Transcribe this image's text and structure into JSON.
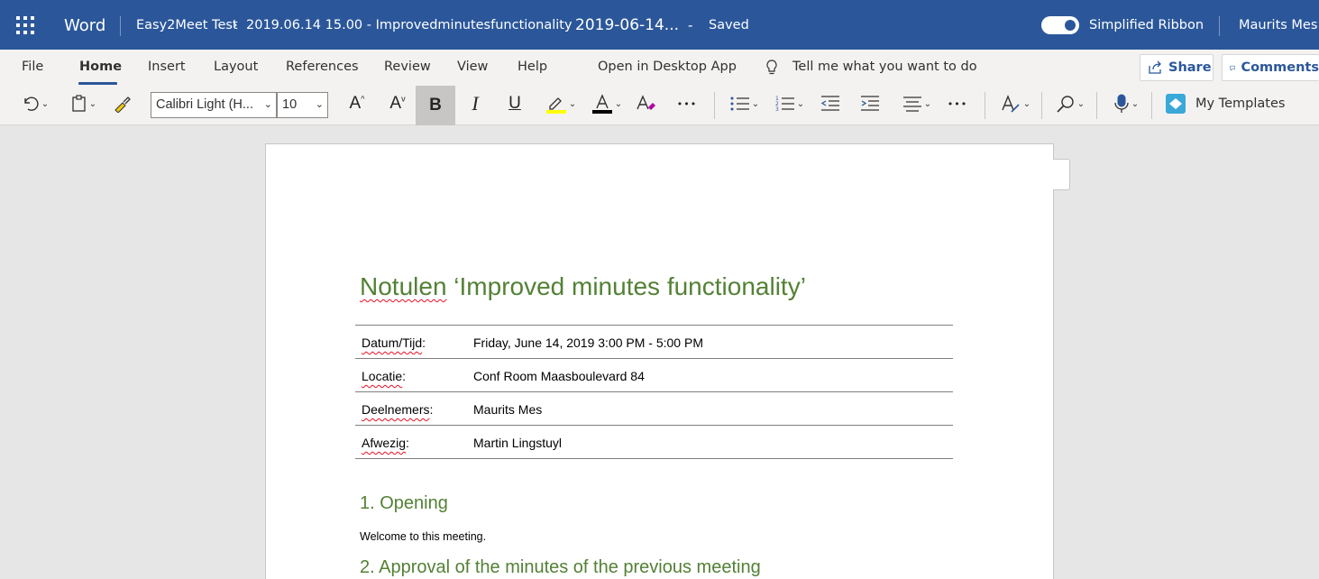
{
  "titlebar": {
    "app_name": "Word",
    "breadcrumb_root": "Easy2Meet Test",
    "breadcrumb_doc": "2019.06.14 15.00 - Improvedminutesfunctionality",
    "doc_name": "2019-06-14...",
    "separator": "-",
    "status": "Saved",
    "simplified_ribbon_label": "Simplified Ribbon",
    "simplified_ribbon_on": true,
    "user_name": "Maurits Mes"
  },
  "ribbon": {
    "tabs": [
      "File",
      "Home",
      "Insert",
      "Layout",
      "References",
      "Review",
      "View",
      "Help"
    ],
    "active_tab": "Home",
    "open_desktop": "Open in Desktop App",
    "tell_me": "Tell me what you want to do",
    "share_label": "Share",
    "comments_label": "Comments",
    "font_name": "Calibri Light (H...",
    "font_size": "10",
    "bold_label": "B",
    "italic_label": "I",
    "underline_label": "U",
    "templates_label": "My Templates",
    "more_label": "•••",
    "colors": {
      "accent": "#2b579a",
      "highlight": "#ffff00",
      "font_color": "#000000",
      "heading": "#538135"
    }
  },
  "document": {
    "title_word": "Notulen",
    "title_rest": " ‘Improved minutes functionality’",
    "meta": [
      {
        "key": "Datum/Tijd",
        "colon": ":",
        "value": "Friday, June 14, 2019 3:00 PM - 5:00 PM"
      },
      {
        "key": "Locatie",
        "colon": ":",
        "value": "Conf Room Maasboulevard 84"
      },
      {
        "key": "Deelnemers",
        "colon": ":",
        "value": "Maurits Mes"
      },
      {
        "key": "Afwezig",
        "colon": ":",
        "value": "Martin Lingstuyl"
      }
    ],
    "h1_opening": "1. Opening",
    "welcome": "Welcome to this meeting.",
    "h1_approval": "2. Approval of the minutes of the previous meeting"
  }
}
